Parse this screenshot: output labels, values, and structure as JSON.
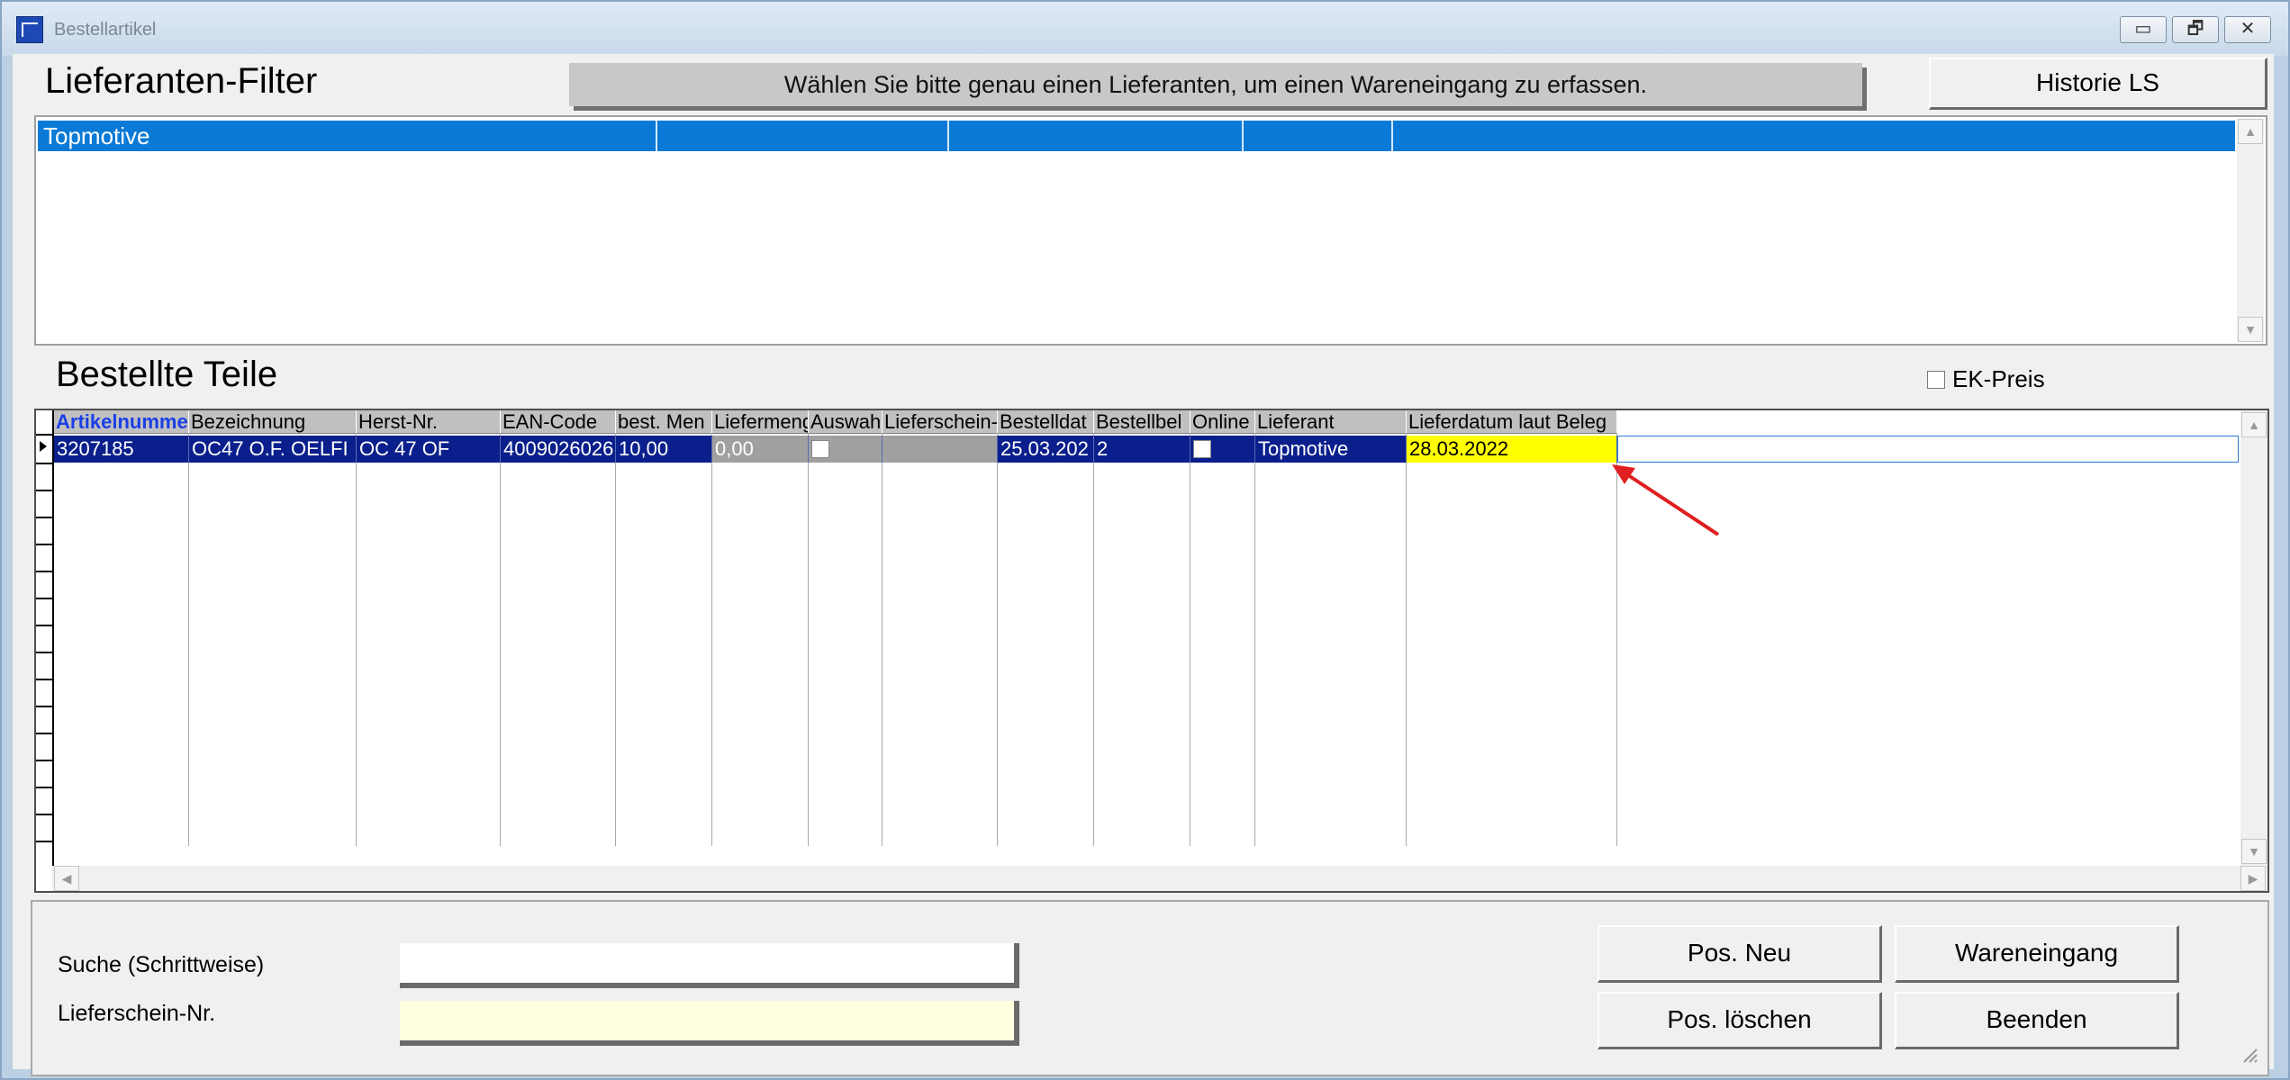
{
  "window": {
    "title": "Bestellartikel",
    "minimize": "▭",
    "restore": "🗗",
    "close": "✕"
  },
  "filter": {
    "heading": "Lieferanten-Filter",
    "hint": "Wählen Sie bitte genau einen Lieferanten, um einen Wareneingang zu erfassen.",
    "history_button": "Historie LS",
    "list_selected": "Topmotive"
  },
  "orders": {
    "heading": "Bestellte Teile",
    "ek_preis_label": "EK-Preis",
    "columns": [
      "Artikelnumme",
      "Bezeichnung",
      "Herst-Nr.",
      "EAN-Code",
      "best. Men",
      "Liefermeng",
      "Auswah",
      "Lieferschein-",
      "Bestelldat",
      "Bestellbel",
      "Online",
      "Lieferant",
      "Lieferdatum laut Beleg"
    ],
    "rows": [
      {
        "artikelnummer": "3207185",
        "bezeichnung": "OC47 O.F. OELFI",
        "herst_nr": "OC 47 OF",
        "ean": "4009026026",
        "best_menge": "10,00",
        "liefermenge": "0,00",
        "lieferschein": "",
        "bestelldatum": "25.03.202",
        "bestellbeleg": "2",
        "lieferant": "Topmotive",
        "lieferdatum": "28.03.2022"
      }
    ]
  },
  "form": {
    "search_label": "Suche (Schrittweise)",
    "search_value": "",
    "delivery_label": "Lieferschein-Nr.",
    "delivery_value": ""
  },
  "buttons": {
    "pos_neu": "Pos. Neu",
    "wareneingang": "Wareneingang",
    "pos_loeschen": "Pos. löschen",
    "beenden": "Beenden"
  },
  "colors": {
    "selection": "#0a7ad6",
    "row_highlight": "#0a1f8c",
    "date_highlight": "#ffff00",
    "annotation_arrow": "#e02020"
  }
}
